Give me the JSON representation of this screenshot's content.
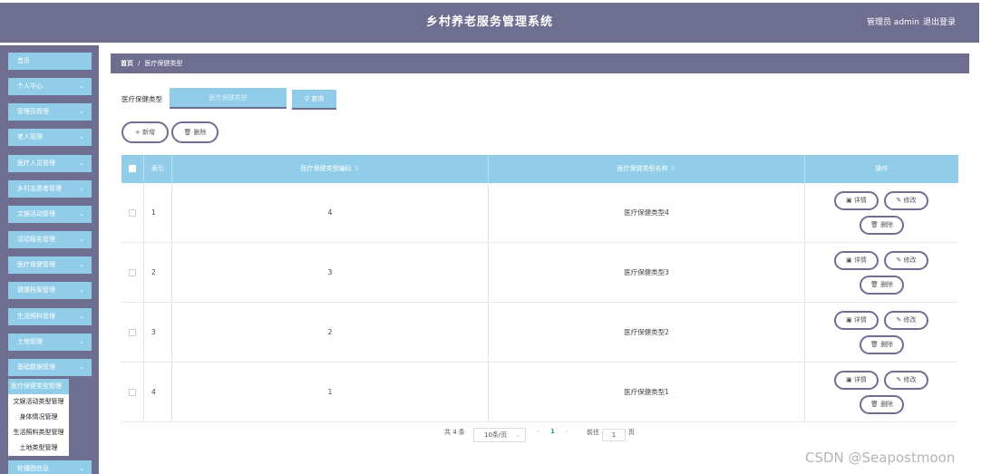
{
  "header": {
    "title": "乡村养老服务管理系统",
    "user": "管理员 admin",
    "logout": "退出登录"
  },
  "sidebar": {
    "items": [
      {
        "label": "首页",
        "chevron": ""
      },
      {
        "label": "个人中心",
        "chevron": "⌄"
      },
      {
        "label": "管理员管理",
        "chevron": "⌄"
      },
      {
        "label": "老人管理",
        "chevron": "⌄"
      },
      {
        "label": "医疗人员管理",
        "chevron": "⌄"
      },
      {
        "label": "乡村志愿者管理",
        "chevron": "⌄"
      },
      {
        "label": "文娱活动管理",
        "chevron": "⌄"
      },
      {
        "label": "活动报名管理",
        "chevron": "⌄"
      },
      {
        "label": "医疗保健管理",
        "chevron": "⌄"
      },
      {
        "label": "健康档案管理",
        "chevron": "⌄"
      },
      {
        "label": "生活照料管理",
        "chevron": "⌄"
      },
      {
        "label": "土地管理",
        "chevron": "⌄"
      },
      {
        "label": "基础数据管理",
        "chevron": "⌄"
      },
      {
        "label": "轮播图信息",
        "chevron": "⌄"
      }
    ],
    "submenu": [
      "医疗保健类型管理",
      "文娱活动类型管理",
      "身体情况管理",
      "生活照料类型管理",
      "土地类型管理"
    ]
  },
  "breadcrumb": {
    "home": "首页",
    "sep": "/",
    "current": "医疗保健类型"
  },
  "search": {
    "label": "医疗保健类型",
    "placeholder": "医疗保健类型",
    "button": "查询",
    "icon": "search-icon"
  },
  "actions": {
    "add": "+ 新增",
    "delete": "删除"
  },
  "table": {
    "columns": {
      "index": "索引",
      "code": "医疗保健类型编码",
      "name": "医疗保健类型名称",
      "ops": "操作"
    },
    "rows": [
      {
        "index": "1",
        "code": "4",
        "name": "医疗保健类型4"
      },
      {
        "index": "2",
        "code": "3",
        "name": "医疗保健类型3"
      },
      {
        "index": "3",
        "code": "2",
        "name": "医疗保健类型2"
      },
      {
        "index": "4",
        "code": "1",
        "name": "医疗保健类型1"
      }
    ],
    "op_labels": {
      "detail": "详情",
      "edit": "修改",
      "delete": "删除"
    }
  },
  "pagination": {
    "total": "共 4 条",
    "page_size": "10条/页",
    "prev": "‹",
    "current": "1",
    "next": "›",
    "goto": "前往",
    "goto_value": "1",
    "page_unit": "页"
  },
  "colors": {
    "primary": "#6e6e91",
    "accent": "#91cde8"
  },
  "watermark": "CSDN @Seapostmoon"
}
